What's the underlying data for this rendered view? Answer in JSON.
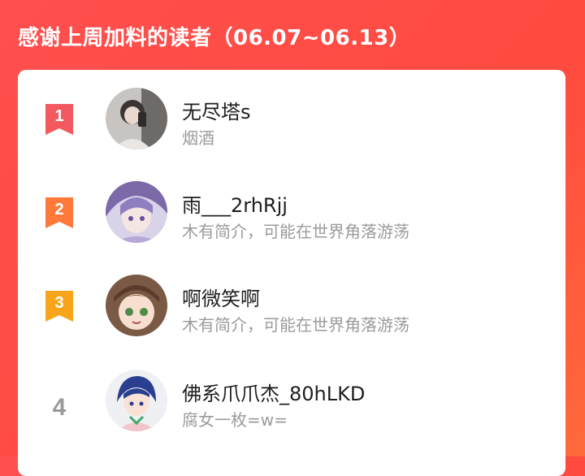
{
  "header": {
    "title": "感谢上周加料的读者（06.07~06.13）"
  },
  "readers": [
    {
      "rank": "1",
      "name": "无尽塔s",
      "bio": "烟酒",
      "badge_color": "#f25a5f"
    },
    {
      "rank": "2",
      "name": "雨___2rhRjj",
      "bio": "木有简介，可能在世界角落游荡",
      "badge_color": "#ff7a3a"
    },
    {
      "rank": "3",
      "name": "啊微笑啊",
      "bio": "木有简介，可能在世界角落游荡",
      "badge_color": "#f8a51c"
    },
    {
      "rank": "4",
      "name": "佛系爪爪杰_80hLKD",
      "bio": "腐女一枚=w=",
      "badge_color": ""
    }
  ]
}
